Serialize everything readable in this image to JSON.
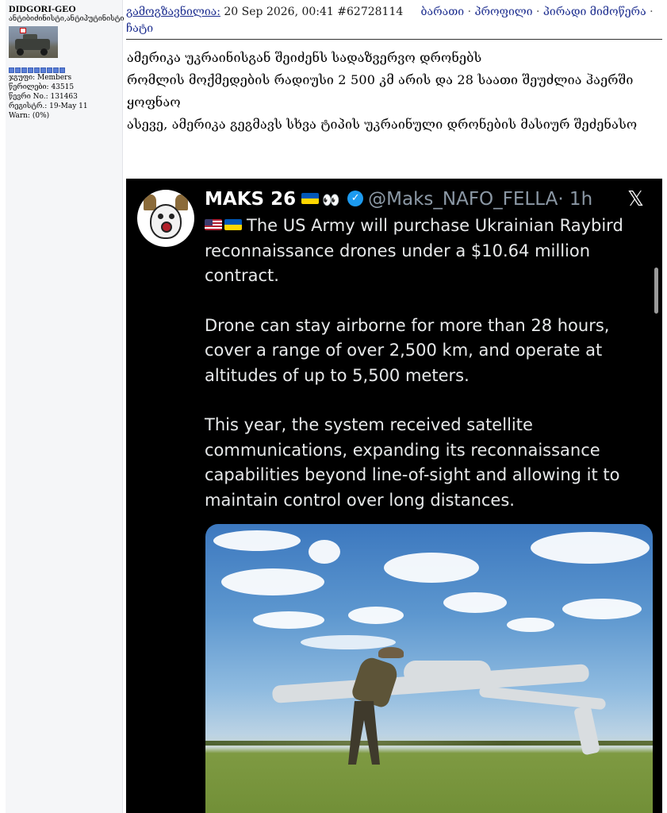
{
  "sidebar": {
    "username": "DIDGORI-GEO",
    "user_title": "ანტიბიძინისტი,ანტიპუტინისტი",
    "stats": [
      "ჯგუფი: Members",
      "წერილები: 43515",
      "წევრი No.: 131463",
      "რეგისტრ.: 19-May 11",
      "Warn: (0%)"
    ]
  },
  "post_header": {
    "sent_label": "გამოგზავნილია:",
    "datetime": "20 Sep 2026, 00:41",
    "post_number": "#62728114",
    "links": [
      "ბარათი",
      "პროფილი",
      "პირადი მიმოწერა",
      "ჩატი"
    ],
    "separator": "·"
  },
  "message": {
    "lines": [
      "ამერიკა უკრაინისგან შეიძენს სადაზვერვო დრონებს",
      "რომლის მოქმედების რადიუსი 2 500 კმ არის და 28 საათი შეუძლია ჰაერში ყოფნაო",
      "ასევე, ამერიკა გეგმავს სხვა ტიპის უკრაინული დრონების მასიურ შეძენასო"
    ]
  },
  "tweet": {
    "display_name": "MAKS 26",
    "eyes_emoji": "👀",
    "handle": "@Maks_NAFO_FELLA",
    "time": "· 1h",
    "x_logo": "𝕏",
    "verified_icon": "✓",
    "paragraphs": [
      "The US Army will purchase Ukrainian Raybird reconnaissance drones under a $10.64 million contract.",
      "Drone can stay airborne for more than 28 hours, cover a range of over 2,500 km, and operate at altitudes of up to 5,500 meters.",
      "This year, the system received satellite communications, expanding its reconnaissance capabilities beyond line-of-sight and allowing it to maintain control over long distances."
    ]
  },
  "colors": {
    "link": "#1d2e8f",
    "tweet_bg": "#000000",
    "verified": "#1d9bf0",
    "stars": "#5b7fd6"
  }
}
